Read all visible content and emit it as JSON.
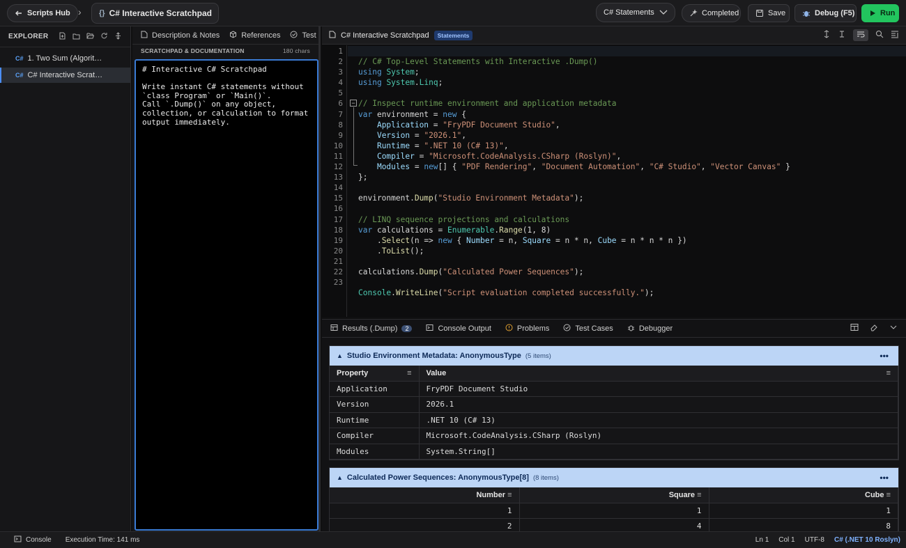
{
  "topbar": {
    "hub_label": "Scripts Hub",
    "breadcrumb_sep": "›",
    "doc_icon": "{}",
    "doc_title": "C# Interactive Scratchpad",
    "mode_select": "C# Statements",
    "status_label": "Completed",
    "save_label": "Save",
    "debug_label": "Debug (F5)",
    "run_label": "Run"
  },
  "explorer": {
    "title": "EXPLORER",
    "items": [
      {
        "label": "1. Two Sum (Algorit…"
      },
      {
        "label": "C# Interactive Scrat…"
      }
    ],
    "lang_badge": "C#"
  },
  "notes": {
    "tabs": [
      {
        "label": "Description & Notes"
      },
      {
        "label": "References"
      },
      {
        "label": "Test"
      }
    ],
    "subheader": "SCRATCHPAD & DOCUMENTATION",
    "char_count": "180 chars",
    "content": "# Interactive C# Scratchpad\n\nWrite instant C# statements without\n`class Program` or `Main()`.\nCall `.Dump()` on any object,\ncollection, or calculation to format\noutput immediately."
  },
  "editor": {
    "file_title": "C# Interactive Scratchpad",
    "badge": "Statements",
    "line_numbers": [
      "1",
      "2",
      "3",
      "4",
      "5",
      "6",
      "7",
      "8",
      "9",
      "10",
      "11",
      "12",
      "13",
      "14",
      "15",
      "16",
      "17",
      "18",
      "19",
      "20",
      "21",
      "22",
      "23"
    ]
  },
  "results": {
    "tabs": [
      {
        "label": "Results (.Dump)",
        "count": "2"
      },
      {
        "label": "Console Output"
      },
      {
        "label": "Problems"
      },
      {
        "label": "Test Cases"
      },
      {
        "label": "Debugger"
      }
    ],
    "panel1": {
      "title": "Studio Environment Metadata: AnonymousType",
      "count": "(5 items)",
      "headers": [
        "Property",
        "Value"
      ],
      "rows": [
        [
          "Application",
          "FryPDF Document Studio"
        ],
        [
          "Version",
          "2026.1"
        ],
        [
          "Runtime",
          ".NET 10 (C# 13)"
        ],
        [
          "Compiler",
          "Microsoft.CodeAnalysis.CSharp (Roslyn)"
        ],
        [
          "Modules",
          "System.String[]"
        ]
      ]
    },
    "panel2": {
      "title": "Calculated Power Sequences: AnonymousType[8]",
      "count": "(8 items)",
      "headers": [
        "Number",
        "Square",
        "Cube"
      ],
      "rows": [
        [
          "1",
          "1",
          "1"
        ],
        [
          "2",
          "4",
          "8"
        ]
      ]
    }
  },
  "status": {
    "console_label": "Console",
    "exec_time": "Execution Time: 141 ms",
    "line": "Ln 1",
    "col": "Col 1",
    "encoding": "UTF-8",
    "language": "C# (.NET 10 Roslyn)"
  },
  "colors": {
    "accent": "#3a7bd5",
    "run": "#22c55e",
    "panel_header": "#bcd5f6"
  }
}
